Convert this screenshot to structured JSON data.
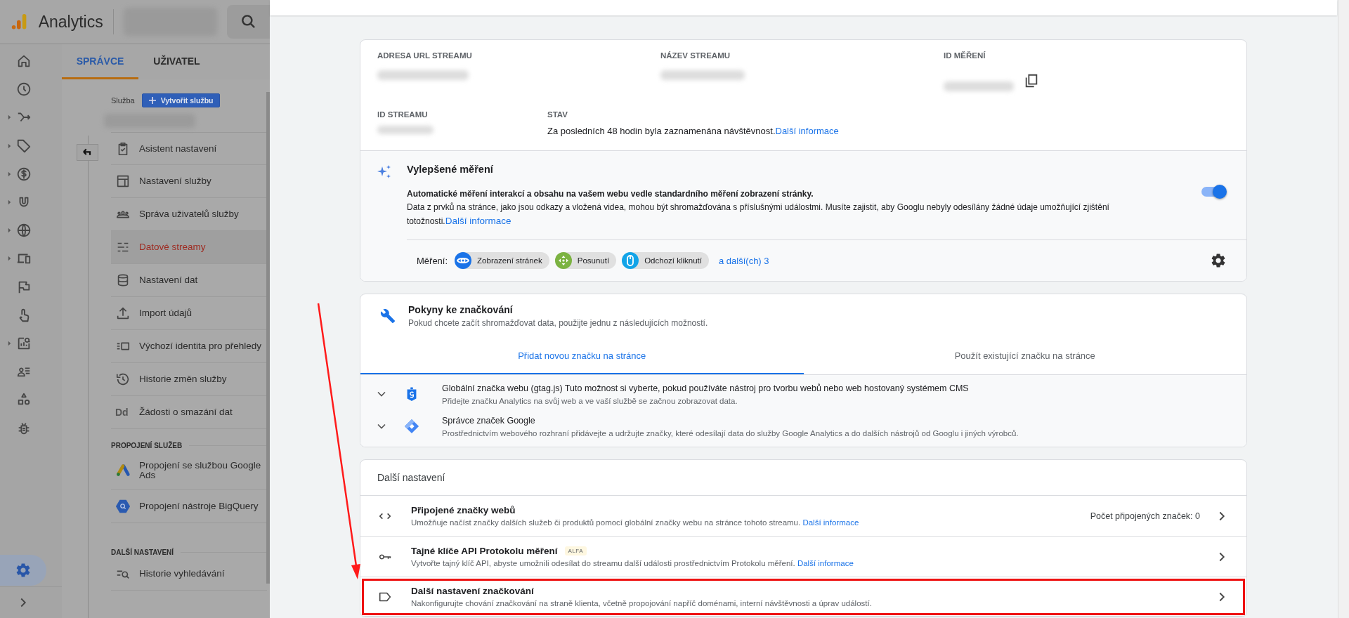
{
  "app": {
    "name": "Analytics"
  },
  "rail": [
    {
      "kind": "home",
      "expandable": false,
      "selected": false
    },
    {
      "kind": "clock",
      "expandable": false,
      "selected": false
    },
    {
      "kind": "branch",
      "expandable": true,
      "selected": false
    },
    {
      "kind": "tag",
      "expandable": true,
      "selected": false
    },
    {
      "kind": "dollar",
      "expandable": true,
      "selected": false
    },
    {
      "kind": "magnet",
      "expandable": true,
      "selected": false
    },
    {
      "kind": "globe",
      "expandable": true,
      "selected": false
    },
    {
      "kind": "devices",
      "expandable": true,
      "selected": false
    },
    {
      "kind": "flag",
      "expandable": false,
      "selected": false
    },
    {
      "kind": "touch",
      "expandable": false,
      "selected": false
    },
    {
      "kind": "report",
      "expandable": true,
      "selected": false
    },
    {
      "kind": "people-list",
      "expandable": false,
      "selected": false
    },
    {
      "kind": "shapes",
      "expandable": false,
      "selected": false
    },
    {
      "kind": "bug",
      "expandable": false,
      "selected": false
    }
  ],
  "rail_settings": {
    "selected": true
  },
  "admin_tabs": [
    {
      "label": "SPRÁVCE",
      "selected": true
    },
    {
      "label": "UŽIVATEL",
      "selected": false
    }
  ],
  "property": {
    "label": "Služba",
    "create_button": "Vytvořit službu"
  },
  "menu_sections": [
    {
      "items": [
        {
          "label": "Asistent nastavení",
          "kind": "clipboard",
          "selected": false
        },
        {
          "label": "Nastavení služby",
          "kind": "layout",
          "selected": false
        },
        {
          "label": "Správa uživatelů služby",
          "kind": "people",
          "selected": false
        },
        {
          "label": "Datové streamy",
          "kind": "streams",
          "selected": true
        },
        {
          "label": "Nastavení dat",
          "kind": "database",
          "selected": false
        },
        {
          "label": "Import údajů",
          "kind": "upload",
          "selected": false
        },
        {
          "label": "Výchozí identita pro přehledy",
          "kind": "identity",
          "selected": false
        },
        {
          "label": "Historie změn služby",
          "kind": "history",
          "selected": false
        },
        {
          "label": "Žádosti o smazání dat",
          "kind": "text",
          "icon_text": "Dd",
          "selected": false
        }
      ]
    },
    {
      "heading": "PROPOJENÍ SLUŽEB",
      "items": [
        {
          "label": "Propojení se službou Google Ads",
          "kind": "ads",
          "selected": false
        },
        {
          "label": "Propojení nástroje BigQuery",
          "kind": "bigquery",
          "selected": false
        }
      ]
    },
    {
      "heading": "DALŠÍ NASTAVENÍ",
      "items": [
        {
          "label": "Historie vyhledávání",
          "kind": "search-history",
          "selected": false
        }
      ]
    }
  ],
  "stream_details": [
    {
      "label": "ADRESA URL STREAMU",
      "copy": false
    },
    {
      "label": "NÁZEV STREAMU",
      "copy": false
    },
    {
      "label": "ID MĚŘENÍ",
      "copy": true
    }
  ],
  "stream_id": {
    "label": "ID STREAMU"
  },
  "status": {
    "label": "STAV",
    "text": "Za posledních 48 hodin byla zaznamenána návštěvnost.",
    "link": "Další informace"
  },
  "enhanced_measurement": {
    "title": "Vylepšené měření",
    "lead": "Automatické měření interakcí a obsahu na vašem webu vedle standardního měření zobrazení stránky.",
    "text": "Data z prvků na stránce, jako jsou odkazy a vložená videa, mohou být shromažďována s příslušnými událostmi. Musíte zajistit, aby Googlu nebyly odesílány žádné údaje umožňující zjištění totožnosti.",
    "link": "Další informace",
    "on": true,
    "measure_label": "Měření:",
    "chips": [
      {
        "label": "Zobrazení stránek",
        "kind": "eye",
        "color": "#1a73e8"
      },
      {
        "label": "Posunutí",
        "kind": "move",
        "color": "#7cb342"
      },
      {
        "label": "Odchozí kliknutí",
        "kind": "mouse",
        "color": "#12a4e8"
      }
    ],
    "more_link": "a další(ch) 3"
  },
  "tagging": {
    "title": "Pokyny ke značkování",
    "subtitle": "Pokud chcete začít shromažďovat data, použijte jednu z následujících možností.",
    "tabs": [
      {
        "label": "Přidat novou značku na stránce",
        "selected": true
      },
      {
        "label": "Použít existující značku na stránce",
        "selected": false
      }
    ],
    "options": [
      {
        "kind": "gtag",
        "title": "**Globální značka webu (gtag.js)** Tuto možnost si vyberte, pokud používáte nástroj pro tvorbu webů nebo web hostovaný systémem CMS",
        "description": "Přidejte značku Analytics na svůj web a ve vaší službě se začnou zobrazovat data.",
        "expanded": false
      },
      {
        "kind": "gtm",
        "title": "**Správce značek Google**",
        "description": "Prostřednictvím webového rozhraní přidávejte a udržujte značky, které odesílají data do služby Google Analytics a do dalších nástrojů od Googlu i jiných výrobců.",
        "expanded": false
      }
    ]
  },
  "more_settings": {
    "heading": "Další nastavení",
    "rows": [
      {
        "kind": "code",
        "title": "Připojené značky webů",
        "description": "Umožňuje načíst značky dalších služeb či produktů pomocí globální značky webu na stránce tohoto streamu.",
        "link": "Další informace",
        "count": "Počet připojených značek: 0",
        "highlighted": false
      },
      {
        "kind": "key",
        "title": "Tajné klíče API Protokolu měření",
        "badge": "ALFA",
        "description": "Vytvořte tajný klíč API, abyste umožnili odesílat do streamu další události prostřednictvím Protokolu měření.",
        "link": "Další informace",
        "highlighted": false
      },
      {
        "kind": "label",
        "title": "Další nastavení značkování",
        "description": "Nakonfigurujte chování značkování na straně klienta, včetně propojování napříč doménami, interní návštěvnosti a úprav událostí.",
        "highlighted": true
      }
    ]
  }
}
